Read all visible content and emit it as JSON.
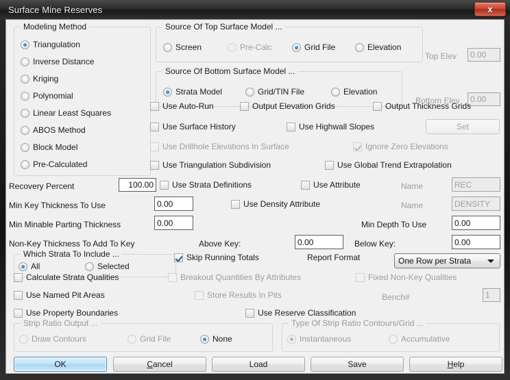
{
  "window": {
    "title": "Surface Mine Reserves",
    "close_label": "x",
    "accent_close": "#cc4732",
    "accent_default_button": "#3c87c4"
  },
  "modeling_method": {
    "title": "Modeling Method",
    "options": [
      {
        "label": "Triangulation",
        "selected": true,
        "disabled": false
      },
      {
        "label": "Inverse Distance",
        "selected": false,
        "disabled": false
      },
      {
        "label": "Kriging",
        "selected": false,
        "disabled": false
      },
      {
        "label": "Polynomial",
        "selected": false,
        "disabled": false
      },
      {
        "label": "Linear Least Squares",
        "selected": false,
        "disabled": false
      },
      {
        "label": "ABOS Method",
        "selected": false,
        "disabled": false
      },
      {
        "label": "Block Model",
        "selected": false,
        "disabled": false
      },
      {
        "label": "Pre-Calculated",
        "selected": false,
        "disabled": false
      }
    ]
  },
  "top_surface": {
    "title": "Source Of Top Surface Model ...",
    "options": [
      {
        "label": "Screen",
        "selected": false,
        "disabled": false
      },
      {
        "label": "Pre-Calc",
        "selected": false,
        "disabled": true
      },
      {
        "label": "Grid File",
        "selected": true,
        "disabled": false
      },
      {
        "label": "Elevation",
        "selected": false,
        "disabled": false
      }
    ],
    "elev_label": "Top Elev",
    "elev_value": "0.00",
    "elev_disabled": true
  },
  "bottom_surface": {
    "title": "Source Of Bottom Surface Model ...",
    "options": [
      {
        "label": "Strata Model",
        "selected": true,
        "disabled": false
      },
      {
        "label": "Grid/TIN File",
        "selected": false,
        "disabled": false
      },
      {
        "label": "Elevation",
        "selected": false,
        "disabled": false
      }
    ],
    "elev_label": "Bottom Elev",
    "elev_value": "0.00",
    "elev_disabled": true
  },
  "options_block": {
    "use_auto_run": {
      "label": "Use Auto-Run",
      "checked": false,
      "disabled": false
    },
    "output_elevation_grids": {
      "label": "Output Elevation Grids",
      "checked": false,
      "disabled": false
    },
    "output_thickness_grids": {
      "label": "Output Thickness Grids",
      "checked": false,
      "disabled": false
    },
    "use_surface_history": {
      "label": "Use Surface History",
      "checked": false,
      "disabled": false
    },
    "use_highwall_slopes": {
      "label": "Use Highwall Slopes",
      "checked": false,
      "disabled": false
    },
    "set_button": {
      "label": "Set",
      "disabled": true
    },
    "use_drillhole_elev": {
      "label": "Use Drillhole Elevations In Surface",
      "checked": false,
      "disabled": true
    },
    "ignore_zero_elev": {
      "label": "Ignore Zero Elevations",
      "checked": true,
      "disabled": true
    },
    "use_tri_subdivision": {
      "label": "Use Triangulation Subdivision",
      "checked": false,
      "disabled": false
    },
    "use_global_trend": {
      "label": "Use Global Trend Extrapolation",
      "checked": false,
      "disabled": false
    }
  },
  "params": {
    "recovery_percent_label": "Recovery Percent",
    "recovery_percent_value": "100.00",
    "use_strata_definitions": {
      "label": "Use Strata Definitions",
      "checked": false,
      "disabled": false
    },
    "use_attribute": {
      "label": "Use Attribute",
      "checked": false,
      "disabled": false
    },
    "rec_name_label": "Name",
    "rec_name_value": "REC",
    "min_key_thickness_label": "Min Key Thickness To Use",
    "min_key_thickness_value": "0.00",
    "use_density_attribute": {
      "label": "Use Density Attribute",
      "checked": false,
      "disabled": false
    },
    "density_name_label": "Name",
    "density_name_value": "DENSITY",
    "min_minable_parting_label": "Min Minable Parting Thickness",
    "min_minable_parting_value": "0.00",
    "min_depth_label": "Min Depth To Use",
    "min_depth_value": "0.00",
    "non_key_thickness_label": "Non-Key Thickness To Add To Key",
    "above_key_label": "Above Key:",
    "above_key_value": "0.00",
    "below_key_label": "Below Key:",
    "below_key_value": "0.00"
  },
  "which_strata": {
    "title": "Which Strata To Include ...",
    "options": [
      {
        "label": "All",
        "selected": true,
        "disabled": false
      },
      {
        "label": "Selected",
        "selected": false,
        "disabled": false
      }
    ]
  },
  "report": {
    "skip_running_totals": {
      "label": "Skip Running Totals",
      "checked": true,
      "disabled": false
    },
    "format_label": "Report Format",
    "format_value": "One Row per Strata",
    "format_options": [
      "One Row per Strata"
    ]
  },
  "flags": {
    "calculate_strata_qualities": {
      "label": "Calculate Strata Qualities",
      "checked": false,
      "disabled": false
    },
    "breakout_quantities": {
      "label": "Breakout Quantities By Attributes",
      "checked": false,
      "disabled": true
    },
    "fixed_non_key_qualities": {
      "label": "Fixed Non-Key Qualities",
      "checked": false,
      "disabled": true
    },
    "use_named_pit_areas": {
      "label": "Use Named Pit Areas",
      "checked": false,
      "disabled": false
    },
    "store_results_in_pits": {
      "label": "Store Results In Pits",
      "checked": false,
      "disabled": true
    },
    "bench_label": "Bench#",
    "bench_value": "1",
    "use_property_boundaries": {
      "label": "Use Property Boundaries",
      "checked": false,
      "disabled": false
    },
    "use_reserve_classification": {
      "label": "Use Reserve Classification",
      "checked": false,
      "disabled": false
    }
  },
  "strip_ratio_output": {
    "title": "Strip Ratio Output ...",
    "options": [
      {
        "label": "Draw Contours",
        "selected": false,
        "disabled": true
      },
      {
        "label": "Grid File",
        "selected": false,
        "disabled": true
      },
      {
        "label": "None",
        "selected": true,
        "disabled": false
      }
    ]
  },
  "strip_ratio_type": {
    "title": "Type Of Strip Ratio Contours/Grid ...",
    "options": [
      {
        "label": "Instantaneous",
        "selected": true,
        "disabled": true
      },
      {
        "label": "Accumulative",
        "selected": false,
        "disabled": true
      }
    ]
  },
  "buttons": {
    "ok": {
      "label": "OK",
      "mnemonic": ""
    },
    "cancel": {
      "label": "Cancel",
      "mnemonic": "C"
    },
    "load": {
      "label": "Load",
      "mnemonic": ""
    },
    "save": {
      "label": "Save",
      "mnemonic": ""
    },
    "help": {
      "label": "Help",
      "mnemonic": "H"
    }
  }
}
